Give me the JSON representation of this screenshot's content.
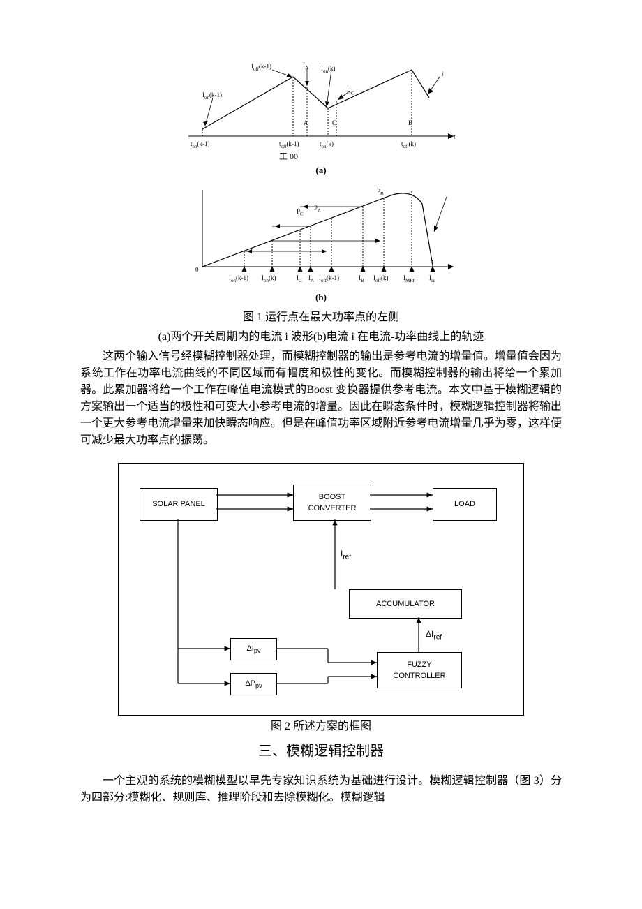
{
  "fig1": {
    "a": {
      "labels": {
        "ion_km1": "I<sub>on</sub>(k-1)",
        "ioff_km1": "I<sub>off</sub>(k-1)",
        "ia": "I<sub>A</sub>",
        "ion_k": "I<sub>on</sub>(k)",
        "ic": "I<sub>C</sub>",
        "i": "i",
        "ton_km1": "t<sub>on</sub>(k-1)",
        "toff_km1": "t<sub>off</sub>(k-1)",
        "ton_k": "t<sub>on</sub>(k)",
        "toff_k": "t<sub>off</sub>(k)",
        "t": "t",
        "A": "A",
        "C": "C",
        "B": "B"
      },
      "footnote": "工 00",
      "sublabel": "(a)"
    },
    "b": {
      "labels": {
        "ion_km1": "I<sub>on</sub>(k-1)",
        "ion_k": "I<sub>on</sub>(k)",
        "ic": "I<sub>C</sub>",
        "ia": "I<sub>A</sub>",
        "ioff_km1": "I<sub>off</sub>(k-1)",
        "ib": "I<sub>B</sub>",
        "ioff_k": "I<sub>off</sub>(k)",
        "impp": "I<sub>MPP</sub>",
        "isc": "I<sub>sc</sub>",
        "pc": "P<sub>C</sub>",
        "pa": "P<sub>A</sub>",
        "pb": "P<sub>B</sub>",
        "zero": "0"
      },
      "sublabel": "(b)"
    },
    "caption": "图 1 运行点在最大功率点的左侧",
    "caption_sub": "(a)两个开关周期内的电流 i 波形(b)电流 i 在电流-功率曲线上的轨迹"
  },
  "para1": "这两个输入信号经模糊控制器处理，而模糊控制器的输出是参考电流的增量值。增量值会因为系统工作在功率电流曲线的不同区域而有幅度和极性的变化。而模糊控制器的输出将给一个累加器。此累加器将给一个工作在峰值电流模式的Boost 变换器提供参考电流。本文中基于模糊逻辑的方案输出一个适当的极性和可变大小参考电流的增量。因此在瞬态条件时，模糊逻辑控制器将输出一个更大参考电流增量来加快瞬态响应。但是在峰值功率区域附近参考电流增量几乎为零，这样便可减少最大功率点的振荡。",
  "fig2": {
    "boxes": {
      "solar": "SOLAR PANEL",
      "boost": "BOOST\nCONVERTER",
      "load": "LOAD",
      "accum": "ACCUMULATOR",
      "fuzzy": "FUZZY\nCONTROLLER",
      "dipv": "ΔI<sub>pv</sub>",
      "dppv": "ΔP<sub>pv</sub>"
    },
    "labels": {
      "iref": "I<sub>ref</sub>",
      "diref": "ΔI<sub>ref</sub>"
    },
    "caption": "图 2 所述方案的框图"
  },
  "section3": "三、模糊逻辑控制器",
  "para2": "一个主观的系统的模糊模型以早先专家知识系统为基础进行设计。模糊逻辑控制器（图 3）分为四部分:模糊化、规则库、推理阶段和去除模糊化。模糊逻辑"
}
